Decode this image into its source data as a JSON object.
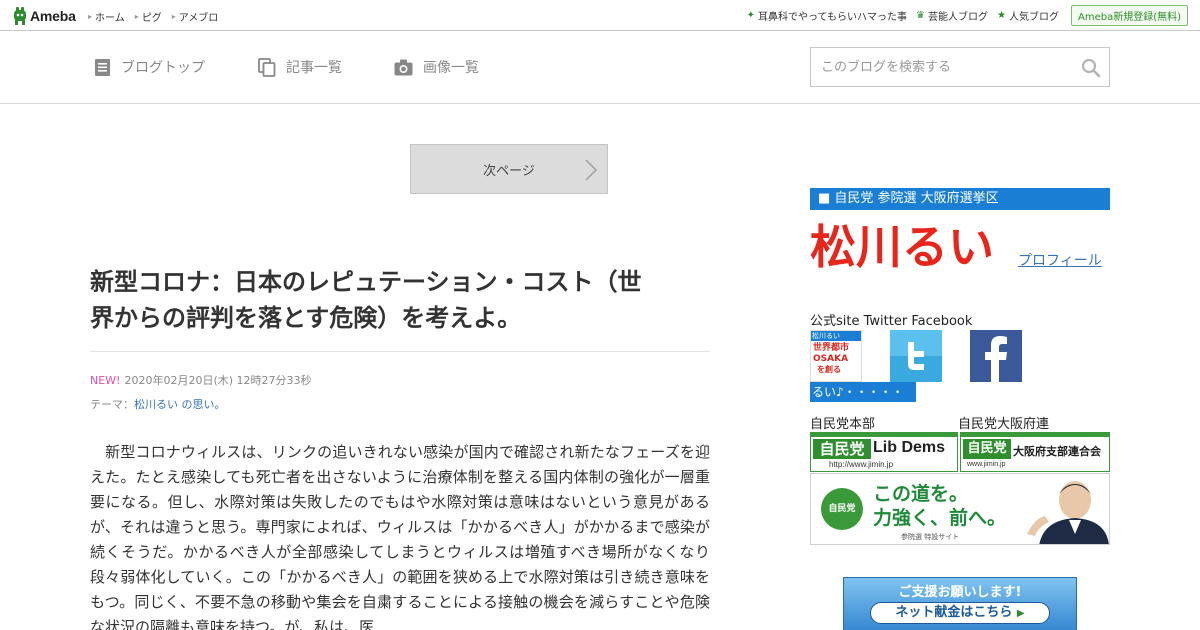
{
  "topbar": {
    "logo_text": "Ameba",
    "nav": [
      "ホーム",
      "ピグ",
      "アメブロ"
    ],
    "links": [
      {
        "label": "耳鼻科でやってもらいハマった事",
        "icon": "sparkle-icon"
      },
      {
        "label": "芸能人ブログ",
        "icon": "crown-icon"
      },
      {
        "label": "人気ブログ",
        "icon": "star-icon"
      }
    ],
    "register_label": "Ameba新規登録(無料)"
  },
  "blognav": {
    "items": [
      {
        "label": "ブログトップ",
        "icon": "document-icon"
      },
      {
        "label": "記事一覧",
        "icon": "copy-icon"
      },
      {
        "label": "画像一覧",
        "icon": "camera-icon"
      }
    ],
    "search_placeholder": "このブログを検索する"
  },
  "pager": {
    "next_label": "次ページ"
  },
  "article": {
    "title_line1": "新型コロナ：日本のレピュテーション・コスト（世",
    "title_line2": "界からの評判を落とす危険）を考えよ。",
    "new_badge": "NEW!",
    "datetime": "2020年02月20日(木) 12時27分33秒",
    "theme_prefix": "テーマ：",
    "theme_label": "松川るい の思い。",
    "body": "　新型コロナウィルスは、リンクの追いきれない感染が国内で確認され新たなフェーズを迎えた。たとえ感染しても死亡者を出さないように治療体制を整える国内体制の強化が一層重要になる。但し、水際対策は失敗したのでもはや水際対策は意味はないという意見があるが、それは違うと思う。専門家によれば、ウィルスは「かかるべき人」がかかるまで感染が続くそうだ。かかるべき人が全部感染してしまうとウィルスは増殖すべき場所がなくなり段々弱体化していく。この「かかるべき人」の範囲を狭める上で水際対策は引き続き意味をもつ。同じく、不要不急の移動や集会を自粛することによる接触の機会を減らすことや危険な状況の隔離も意味を持つ。が、私は、医"
  },
  "sidebar": {
    "header": "■ 自民党 参院選 大阪府選挙区",
    "name": "松川るい",
    "profile_link": "プロフィール",
    "social_label": "公式site  Twitter  Facebook",
    "osaka_banner": {
      "name": "松川るい",
      "line1": "世界都市",
      "line2": "OSAKA",
      "line3": "を創る"
    },
    "strip_text": "るい♪・・・・・",
    "label_hq": "自民党本部",
    "label_osaka": "自民党大阪府連",
    "ldp_banner": {
      "jp": "自民党",
      "en1": "Lib",
      "en2": "Dems",
      "url": "http://www.jimin.jp"
    },
    "ldp_osaka_banner": {
      "jp": "自民党",
      "text": "大阪府支部連合会",
      "url": "www.jimin.jp"
    },
    "abe_banner": {
      "badge": "自民党",
      "line1": "この道を。",
      "line2": "力強く、前へ。",
      "sub": "参院選 特設サイト"
    },
    "donate_banner": {
      "line1": "ご支援お願いします!",
      "button": "ネット献金はこちら"
    }
  }
}
